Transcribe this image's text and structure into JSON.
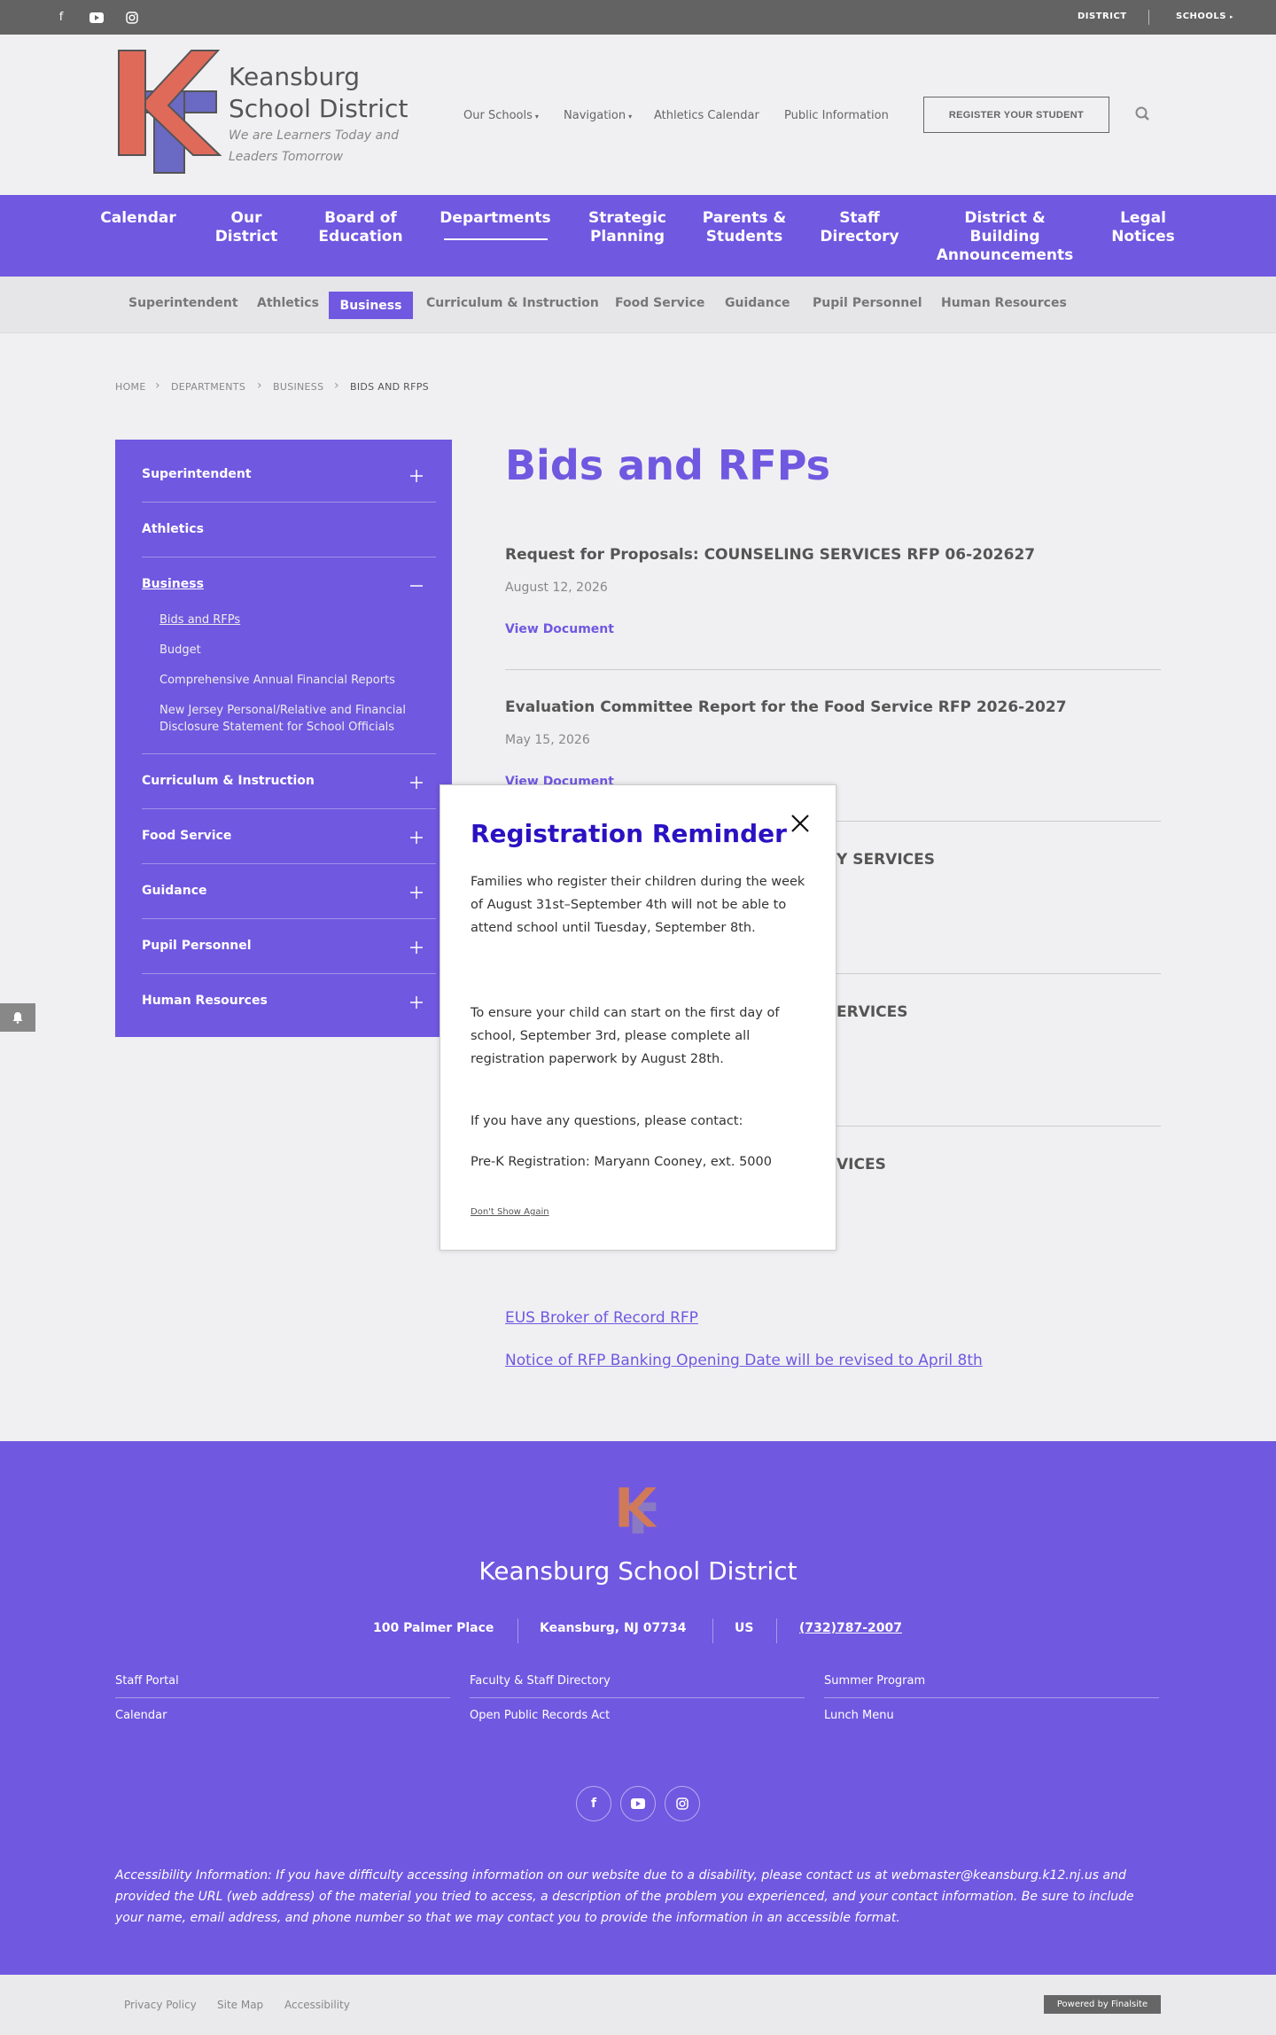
{
  "topbar": {
    "district": "DISTRICT",
    "schools": "SCHOOLS"
  },
  "header": {
    "site_name": "Keansburg School District",
    "tagline": "We are Learners Today and Leaders Tomorrow",
    "nav": [
      "Our Schools",
      "Navigation",
      "Athletics Calendar",
      "Public Information"
    ],
    "register": "REGISTER YOUR STUDENT"
  },
  "mainnav": [
    "Calendar",
    "Our District",
    "Board of Education",
    "Departments",
    "Strategic Planning",
    "Parents & Students",
    "Staff Directory",
    "District & Building Announcements",
    "Legal Notices"
  ],
  "subnav": [
    "Superintendent",
    "Athletics",
    "Business",
    "Curriculum & Instruction",
    "Food Service",
    "Guidance",
    "Pupil Personnel",
    "Human Resources"
  ],
  "breadcrumb": [
    "HOME",
    "DEPARTMENTS",
    "BUSINESS",
    "BIDS AND RFPS"
  ],
  "sidenav": {
    "items": [
      "Superintendent",
      "Athletics",
      "Business",
      "Curriculum & Instruction",
      "Food Service",
      "Guidance",
      "Pupil Personnel",
      "Human Resources"
    ],
    "business_sub": [
      "Bids and RFPs",
      "Budget",
      "Comprehensive Annual Financial Reports",
      "New Jersey Personal/Relative and Financial Disclosure Statement for School Officials"
    ]
  },
  "content": {
    "title": "Bids and RFPs",
    "bids": [
      {
        "title": "Request for Proposals: COUNSELING SERVICES RFP 06-202627",
        "date": "August 12, 2026",
        "link": "View Document"
      },
      {
        "title": "Evaluation Committee Report for the Food Service RFP 2026-2027",
        "date": "May 15, 2026",
        "link": "View Document"
      }
    ],
    "partial_titles": [
      "Y SERVICES",
      "ERVICES",
      "VICES"
    ],
    "links": [
      "EUS Broker of Record RFP",
      "Notice of RFP Banking Opening Date will be revised to April 8th"
    ]
  },
  "modal": {
    "title": "Registration Reminder",
    "p1": "Families who register their children during the week of August 31st–September 4th will not be able to attend school until Tuesday, September 8th.",
    "p2": "To ensure your child can start on the first day of school, September 3rd, please complete all registration paperwork by August 28th.",
    "p3": "If you have any questions, please contact:",
    "p4": "Pre-K Registration: Maryann Cooney, ext. 5000",
    "dont_show": "Don't Show Again"
  },
  "footer": {
    "name": "Keansburg School District",
    "address": "100 Palmer Place",
    "city": "Keansburg, NJ  07734",
    "country": "US",
    "phone": "(732)787-2007",
    "links": [
      "Staff Portal",
      "Calendar",
      "Faculty & Staff Directory",
      "Open Public Records Act",
      "Summer Program",
      "Lunch Menu"
    ],
    "accessibility": "Accessibility Information: If you have difficulty accessing information on our website due to a disability, please contact us at webmaster@keansburg.k12.nj.us and provided the URL (web address) of the material you tried to access, a description of the problem you experienced, and your contact information. Be sure to include your name, email address, and phone number so that we may contact you to provide the information in an accessible format."
  },
  "bottom": {
    "links": [
      "Privacy Policy",
      "Site Map",
      "Accessibility"
    ],
    "powered": "Powered by Finalsite"
  },
  "colors": {
    "brand": "#7058e0",
    "modal_title": "#2a12c2",
    "topbar": "#636363"
  }
}
